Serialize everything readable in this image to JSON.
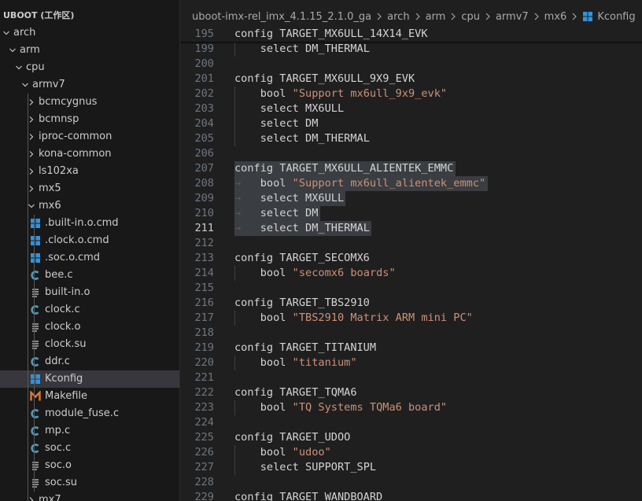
{
  "workspace": {
    "title": "UBOOT (工作区)"
  },
  "tree": [
    {
      "label": "arch",
      "kind": "folder",
      "open": true,
      "depth": 0
    },
    {
      "label": "arm",
      "kind": "folder",
      "open": true,
      "depth": 1
    },
    {
      "label": "cpu",
      "kind": "folder",
      "open": true,
      "depth": 2
    },
    {
      "label": "armv7",
      "kind": "folder",
      "open": true,
      "depth": 3
    },
    {
      "label": "bcmcygnus",
      "kind": "folder",
      "open": false,
      "depth": 4
    },
    {
      "label": "bcmnsp",
      "kind": "folder",
      "open": false,
      "depth": 4
    },
    {
      "label": "iproc-common",
      "kind": "folder",
      "open": false,
      "depth": 4
    },
    {
      "label": "kona-common",
      "kind": "folder",
      "open": false,
      "depth": 4
    },
    {
      "label": "ls102xa",
      "kind": "folder",
      "open": false,
      "depth": 4
    },
    {
      "label": "mx5",
      "kind": "folder",
      "open": false,
      "depth": 4
    },
    {
      "label": "mx6",
      "kind": "folder",
      "open": true,
      "depth": 4
    },
    {
      "label": ".built-in.o.cmd",
      "kind": "win",
      "depth": 5
    },
    {
      "label": ".clock.o.cmd",
      "kind": "win",
      "depth": 5
    },
    {
      "label": ".soc.o.cmd",
      "kind": "win",
      "depth": 5
    },
    {
      "label": "bee.c",
      "kind": "c",
      "depth": 5
    },
    {
      "label": "built-in.o",
      "kind": "lines",
      "depth": 5
    },
    {
      "label": "clock.c",
      "kind": "c",
      "depth": 5
    },
    {
      "label": "clock.o",
      "kind": "lines",
      "depth": 5
    },
    {
      "label": "clock.su",
      "kind": "lines",
      "depth": 5
    },
    {
      "label": "ddr.c",
      "kind": "c",
      "depth": 5
    },
    {
      "label": "Kconfig",
      "kind": "win",
      "depth": 5,
      "selected": true
    },
    {
      "label": "Makefile",
      "kind": "make",
      "depth": 5
    },
    {
      "label": "module_fuse.c",
      "kind": "c",
      "depth": 5
    },
    {
      "label": "mp.c",
      "kind": "c",
      "depth": 5
    },
    {
      "label": "soc.c",
      "kind": "c",
      "depth": 5
    },
    {
      "label": "soc.o",
      "kind": "lines",
      "depth": 5
    },
    {
      "label": "soc.su",
      "kind": "lines",
      "depth": 5
    },
    {
      "label": "mx7",
      "kind": "folder",
      "open": false,
      "depth": 4
    }
  ],
  "breadcrumb": [
    "uboot-imx-rel_imx_4.1.15_2.1.0_ga",
    "arch",
    "arm",
    "cpu",
    "armv7",
    "mx6",
    "Kconfig"
  ],
  "editor": {
    "current_line": "211",
    "sticky": {
      "num": "195",
      "text": "config TARGET_MX6ULL_14X14_EVK"
    },
    "lines": [
      {
        "num": "199",
        "indent": true,
        "kw": "select",
        "rest": " DM_THERMAL"
      },
      {
        "num": "200",
        "kw": "",
        "rest": ""
      },
      {
        "num": "201",
        "kw": "config",
        "rest": " TARGET_MX6ULL_9X9_EVK"
      },
      {
        "num": "202",
        "indent": true,
        "kw": "bool",
        "str": " \"Support mx6ull_9x9_evk\""
      },
      {
        "num": "203",
        "indent": true,
        "kw": "select",
        "rest": " MX6ULL"
      },
      {
        "num": "204",
        "indent": true,
        "kw": "select",
        "rest": " DM"
      },
      {
        "num": "205",
        "indent": true,
        "kw": "select",
        "rest": " DM_THERMAL"
      },
      {
        "num": "206",
        "kw": "",
        "rest": ""
      },
      {
        "num": "207",
        "kw": "config",
        "rest": " TARGET_MX6ULL_ALIENTEK_EMMC",
        "sel": true
      },
      {
        "num": "208",
        "indent": true,
        "tab": true,
        "kw": "bool",
        "str": " \"Support mx6ull_alientek_emmc\"",
        "sel": true
      },
      {
        "num": "209",
        "indent": true,
        "tab": true,
        "kw": "select",
        "rest": " MX6ULL",
        "sel": true
      },
      {
        "num": "210",
        "indent": true,
        "tab": true,
        "kw": "select",
        "rest": " DM",
        "sel": true
      },
      {
        "num": "211",
        "indent": true,
        "tab": true,
        "kw": "select",
        "rest": " DM_THERMAL",
        "sel": true
      },
      {
        "num": "212",
        "kw": "",
        "rest": ""
      },
      {
        "num": "213",
        "kw": "config",
        "rest": " TARGET_SECOMX6"
      },
      {
        "num": "214",
        "indent": true,
        "kw": "bool",
        "str": " \"secomx6 boards\""
      },
      {
        "num": "215",
        "kw": "",
        "rest": ""
      },
      {
        "num": "216",
        "kw": "config",
        "rest": " TARGET_TBS2910"
      },
      {
        "num": "217",
        "indent": true,
        "kw": "bool",
        "str": " \"TBS2910 Matrix ARM mini PC\""
      },
      {
        "num": "218",
        "kw": "",
        "rest": ""
      },
      {
        "num": "219",
        "kw": "config",
        "rest": " TARGET_TITANIUM"
      },
      {
        "num": "220",
        "indent": true,
        "kw": "bool",
        "str": " \"titanium\""
      },
      {
        "num": "221",
        "kw": "",
        "rest": ""
      },
      {
        "num": "222",
        "kw": "config",
        "rest": " TARGET_TQMA6"
      },
      {
        "num": "223",
        "indent": true,
        "kw": "bool",
        "str": " \"TQ Systems TQMa6 board\""
      },
      {
        "num": "224",
        "kw": "",
        "rest": ""
      },
      {
        "num": "225",
        "kw": "config",
        "rest": " TARGET_UDOO"
      },
      {
        "num": "226",
        "indent": true,
        "kw": "bool",
        "str": " \"udoo\""
      },
      {
        "num": "227",
        "indent": true,
        "kw": "select",
        "rest": " SUPPORT_SPL"
      },
      {
        "num": "228",
        "kw": "",
        "rest": ""
      },
      {
        "num": "229",
        "kw": "config",
        "rest": " TARGET_WANDBOARD"
      }
    ]
  },
  "icons": {
    "folder_closed": "chevron-right-icon",
    "folder_open": "chevron-down-icon",
    "win": "windows-icon",
    "c": "c-file-icon",
    "lines": "text-file-icon",
    "make": "makefile-icon",
    "tab_arrow": "→"
  },
  "colors": {
    "bg": "#1f1f1f",
    "sidebar": "#181818",
    "selected": "#37373d",
    "c_icon": "#519aba",
    "win_icon": "#2f94e0",
    "make_icon": "#e37933",
    "string": "#ce9178",
    "selection": "#3a3d41"
  }
}
